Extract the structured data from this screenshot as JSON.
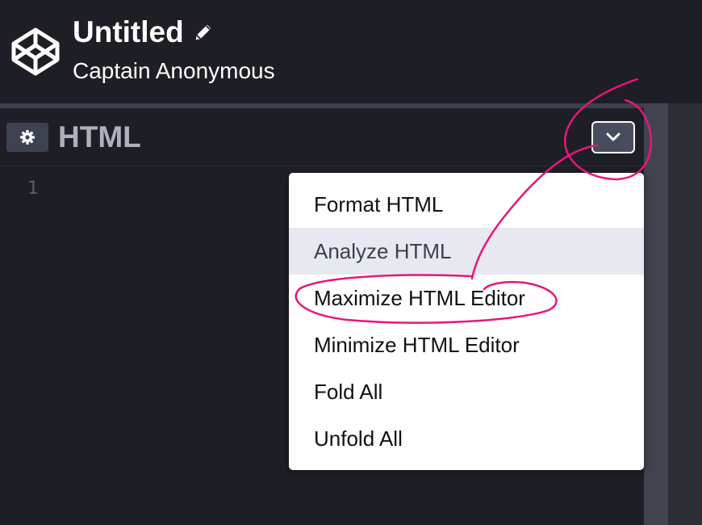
{
  "header": {
    "title": "Untitled",
    "author": "Captain Anonymous",
    "logo_icon": "codepen-logo-icon",
    "edit_icon": "pencil-icon"
  },
  "editor": {
    "title": "HTML",
    "settings_icon": "gear-icon",
    "dropdown_icon": "chevron-down-icon",
    "line_numbers": [
      "1"
    ]
  },
  "menu": {
    "items": [
      {
        "label": "Format HTML"
      },
      {
        "label": "Analyze HTML",
        "state": "hover"
      },
      {
        "label": "Maximize HTML Editor",
        "state": "annotated"
      },
      {
        "label": "Minimize HTML Editor"
      },
      {
        "label": "Fold All"
      },
      {
        "label": "Unfold All"
      }
    ]
  },
  "colors": {
    "annotation": "#e8157a",
    "background": "#1e1f26",
    "menu_hover": "#e8e8f1"
  }
}
